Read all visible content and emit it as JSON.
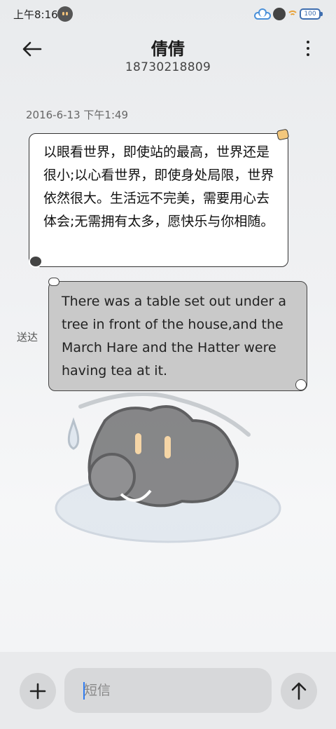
{
  "status_bar": {
    "time": "上午8:16",
    "battery": "100"
  },
  "header": {
    "contact_name": "倩倩",
    "contact_number": "18730218809"
  },
  "chat": {
    "timestamp": "2016-6-13 下午1:49",
    "received_message": "以眼看世界，即使站的最高，世界还是很小;以心看世界，即使身处局限，世界依然很大。生活远不完美，需要用心去体会;无需拥有太多，愿快乐与你相随。",
    "sent_message": "There was a table set out under a tree in front of the house,and the March Hare and the Hatter were having tea at it.",
    "delivered_label": "送达"
  },
  "input": {
    "placeholder": "短信"
  },
  "icons": {
    "back": "arrow-left-icon",
    "more": "more-vertical-icon",
    "attach": "plus-icon",
    "send": "arrow-up-icon",
    "cloud": "cloud-icon",
    "wifi": "wifi-icon",
    "battery": "battery-icon"
  },
  "colors": {
    "received_bubble": "#ffffff",
    "sent_bubble": "#c9c9c9",
    "cursor": "#2f7bf0"
  }
}
